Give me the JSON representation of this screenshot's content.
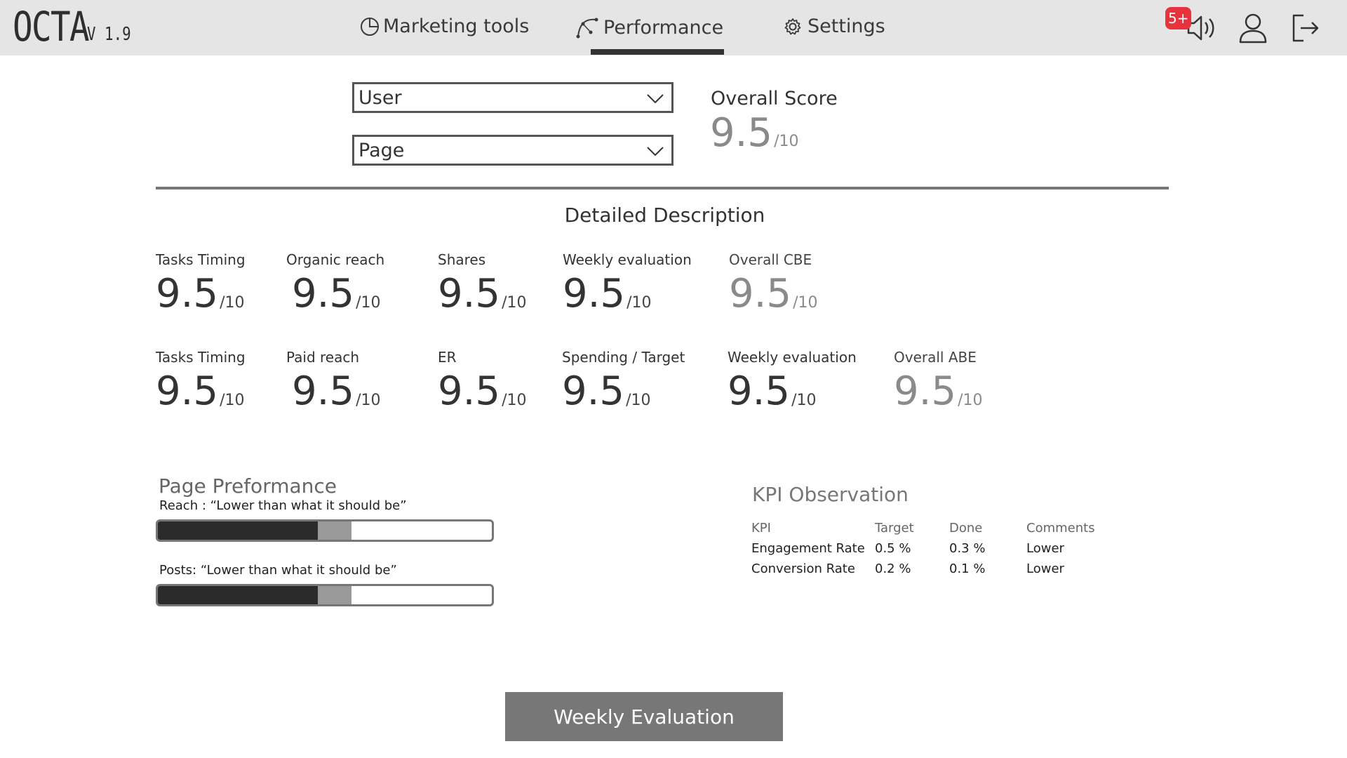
{
  "app": {
    "name": "OCTA",
    "version": "V 1.9"
  },
  "nav": {
    "items": [
      {
        "label": "Marketing tools",
        "icon": "pie-chart-icon"
      },
      {
        "label": "Performance",
        "icon": "curve-tool-icon",
        "active": true
      },
      {
        "label": "Settings",
        "icon": "gear-icon"
      }
    ]
  },
  "header": {
    "notification_badge": "5+",
    "icons": [
      "speaker-icon",
      "user-icon",
      "logout-icon"
    ]
  },
  "filters": {
    "user_select": "User",
    "page_select": "Page"
  },
  "overall": {
    "title": "Overall Score",
    "score": "9.5",
    "unit": "/10"
  },
  "detail": {
    "title": "Detailed Description",
    "row1": [
      {
        "label": "Tasks Timing",
        "score": "9.5",
        "unit": "/10"
      },
      {
        "label": "Organic reach",
        "score": "9.5",
        "unit": "/10"
      },
      {
        "label": "Shares",
        "score": "9.5",
        "unit": "/10"
      },
      {
        "label": "Weekly evaluation",
        "score": "9.5",
        "unit": "/10"
      },
      {
        "label": "Overall CBE",
        "score": "9.5",
        "unit": "/10",
        "muted": true
      }
    ],
    "row2": [
      {
        "label": "Tasks Timing",
        "score": "9.5",
        "unit": "/10"
      },
      {
        "label": "Paid reach",
        "score": "9.5",
        "unit": "/10"
      },
      {
        "label": "ER",
        "score": "9.5",
        "unit": "/10"
      },
      {
        "label": "Spending / Target",
        "score": "9.5",
        "unit": "/10"
      },
      {
        "label": "Weekly evaluation",
        "score": "9.5",
        "unit": "/10"
      },
      {
        "label": "Overall ABE",
        "score": "9.5",
        "unit": "/10",
        "muted": true
      }
    ]
  },
  "page_performance": {
    "title": "Page Preformance",
    "bars": [
      {
        "label": "Reach : “Lower than what it should be”",
        "dark_fraction": 0.48,
        "grey_fraction": 0.1
      },
      {
        "label": "Posts: “Lower than what it should be”",
        "dark_fraction": 0.48,
        "grey_fraction": 0.1
      }
    ]
  },
  "kpi": {
    "title": "KPI Observation",
    "headers": [
      "KPI",
      "Target",
      "Done",
      "Comments"
    ],
    "rows": [
      [
        "Engagement Rate",
        "0.5 %",
        "0.3 %",
        "Lower"
      ],
      [
        "Conversion Rate",
        "0.2 %",
        "0.1 %",
        "Lower"
      ]
    ]
  },
  "cta": {
    "label": "Weekly Evaluation"
  },
  "colors": {
    "header_bg": "#e5e5e5",
    "badge": "#e8323c",
    "accent_dark": "#333333",
    "muted": "#8a8a8a",
    "button": "#777777"
  }
}
